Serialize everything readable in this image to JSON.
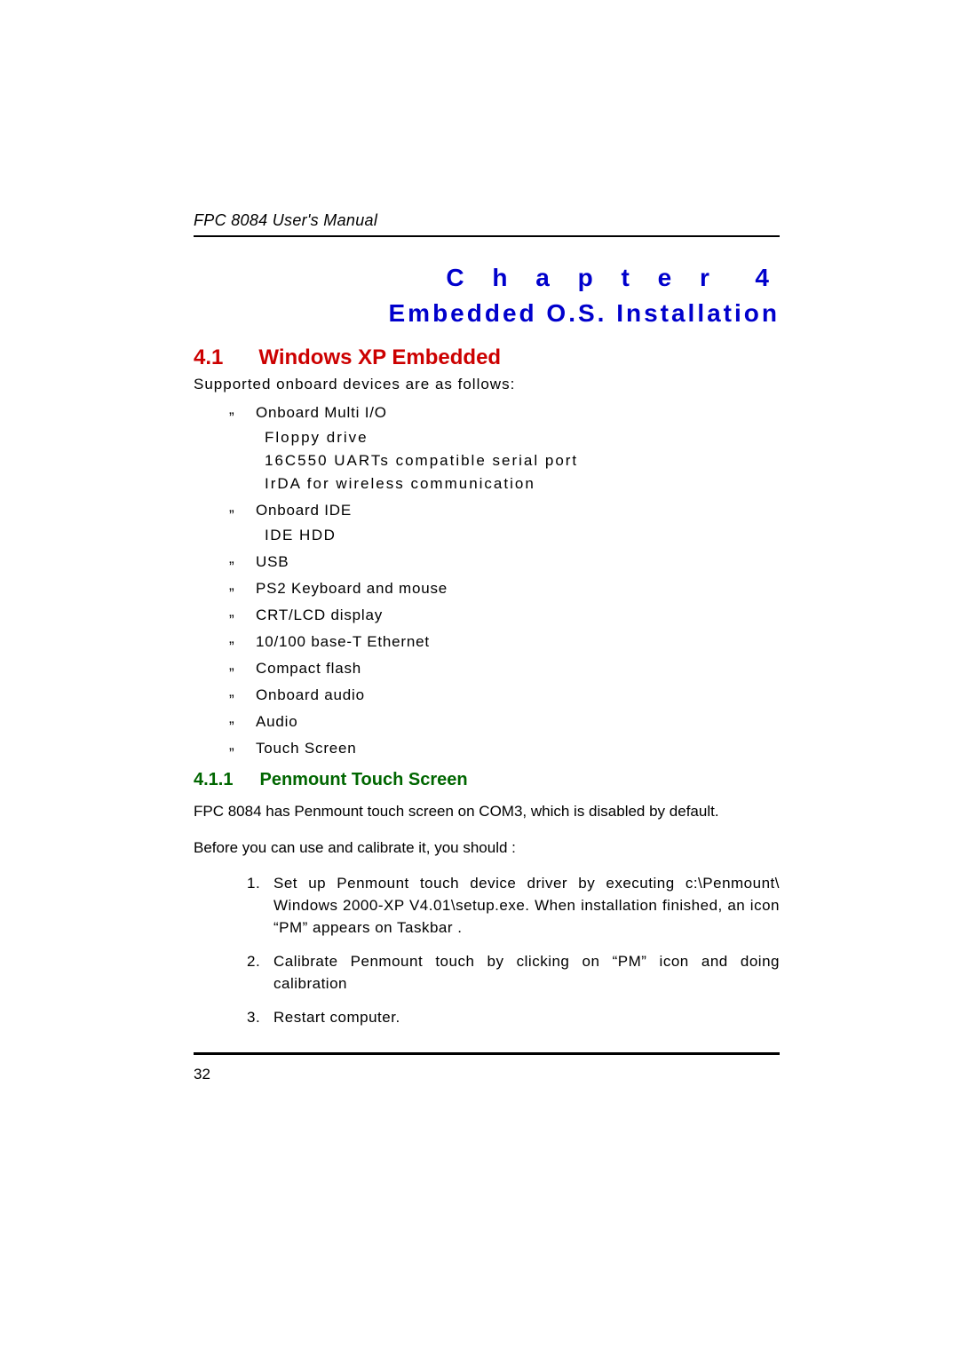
{
  "header": "FPC 8084 User's Manual",
  "chapter": {
    "label": "C h a p t e r",
    "number": "4",
    "title": "Embedded  O.S.  Installation"
  },
  "section": {
    "number": "4.1",
    "title": "Windows XP Embedded",
    "intro": "Supported onboard devices are as follows:",
    "bullets": [
      {
        "label": "Onboard Multi I/O",
        "sub": [
          "Floppy drive",
          "16C550 UARTs compatible serial port",
          "IrDA for wireless communication"
        ]
      },
      {
        "label": "Onboard IDE",
        "sub": [
          "IDE HDD"
        ]
      },
      {
        "label": "USB"
      },
      {
        "label": "PS2 Keyboard and mouse"
      },
      {
        "label": "CRT/LCD display"
      },
      {
        "label": "10/100 base-T Ethernet"
      },
      {
        "label": "Compact flash"
      },
      {
        "label": "Onboard audio"
      },
      {
        "label": "Audio"
      },
      {
        "label": "Touch Screen"
      }
    ]
  },
  "subsection": {
    "number": "4.1.1",
    "title": "Penmount Touch Screen",
    "para1": "FPC 8084 has Penmount touch screen on COM3, which is disabled by default.",
    "para2": "Before you can use and calibrate it, you should :",
    "steps": [
      "Set up Penmount touch device driver by executing c:\\Penmount\\ Windows 2000-XP V4.01\\setup.exe. When installation finished, an icon “PM” appears on Taskbar .",
      "Calibrate Penmount touch by clicking on “PM” icon and doing calibration",
      "Restart computer."
    ]
  },
  "pageNumber": "32"
}
